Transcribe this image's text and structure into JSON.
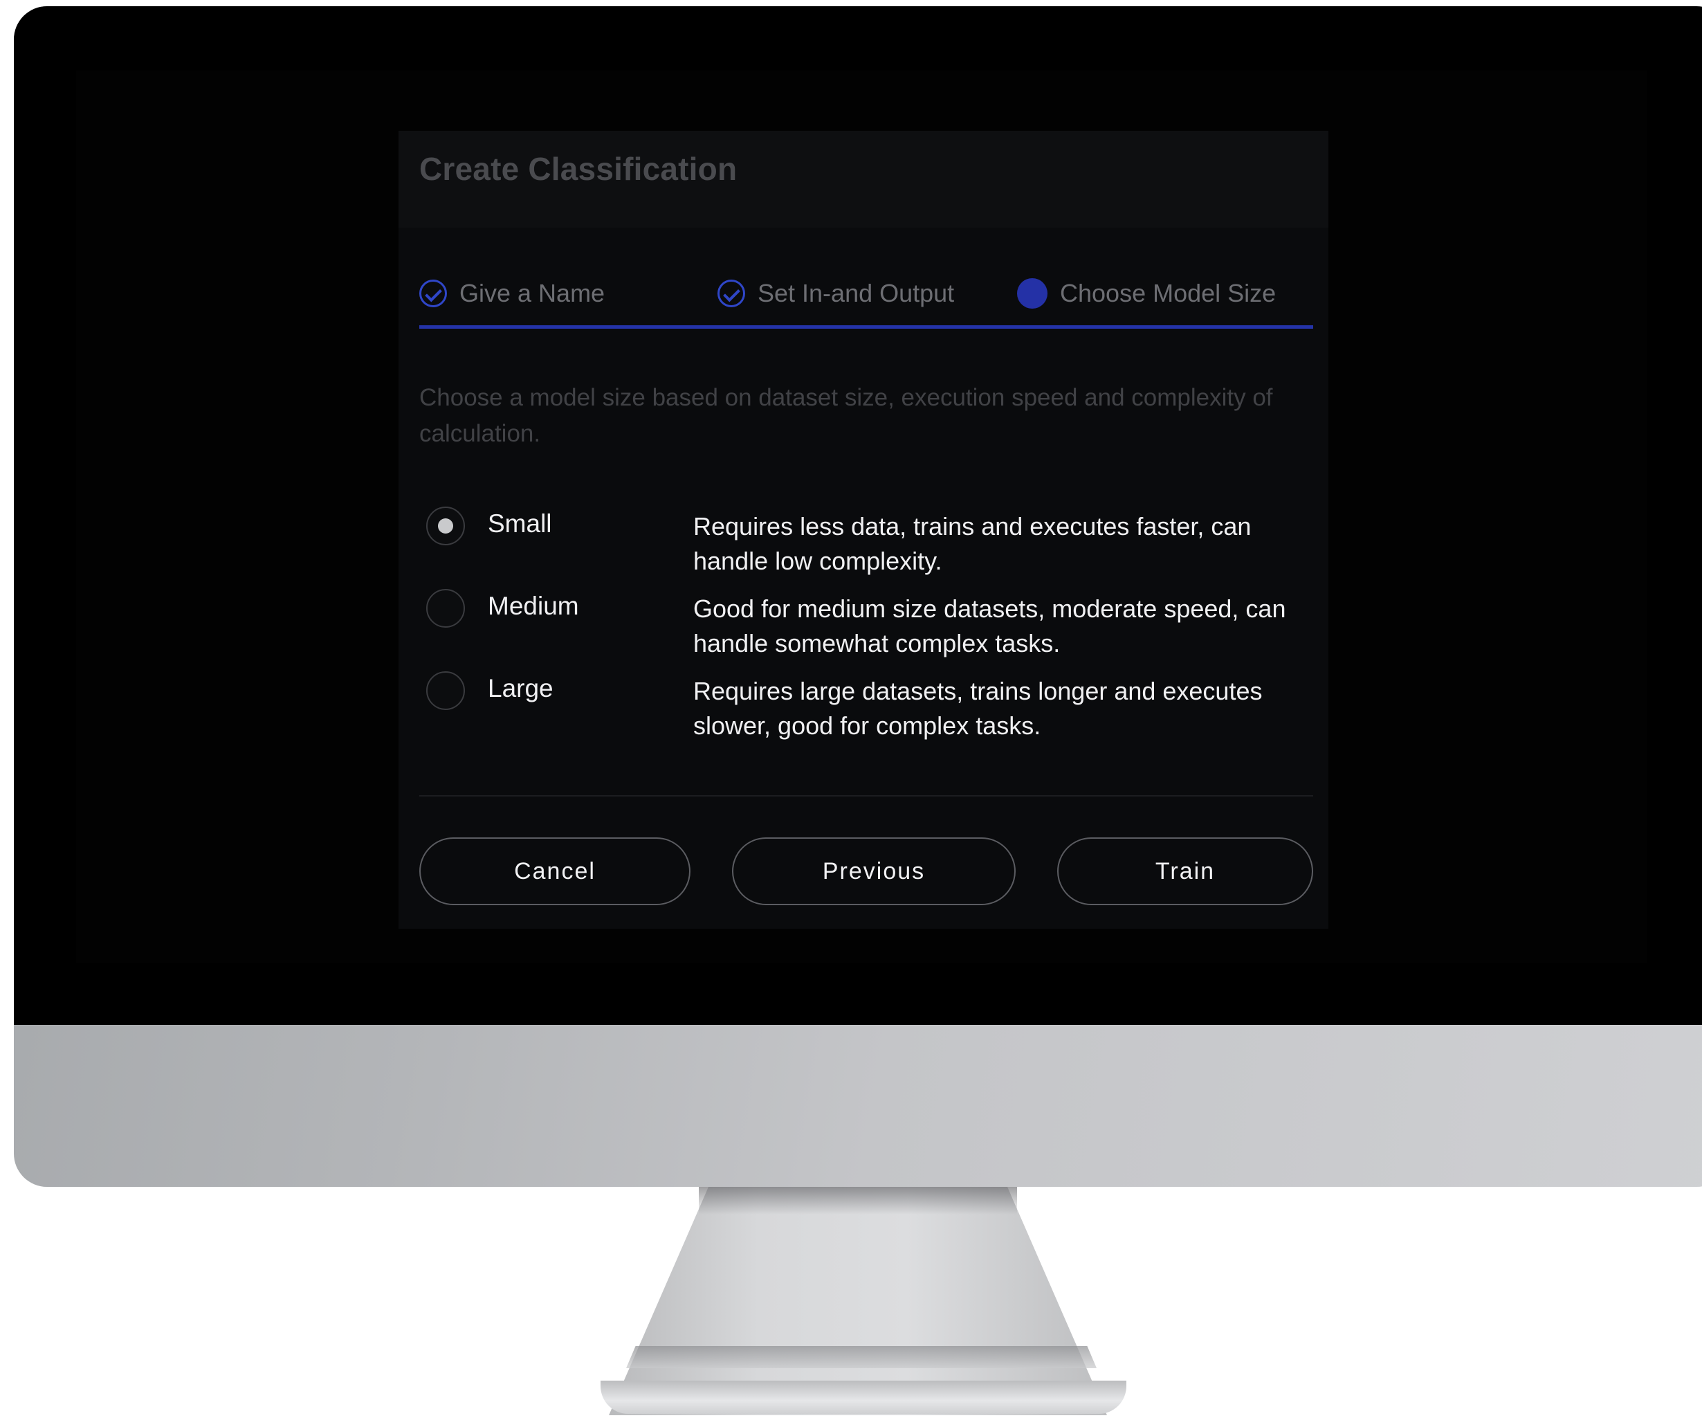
{
  "dialog": {
    "title": "Create Classification",
    "steps": [
      {
        "label": "Give a Name",
        "status": "done"
      },
      {
        "label": "Set In-and Output",
        "status": "done"
      },
      {
        "label": "Choose Model Size",
        "status": "current"
      }
    ],
    "intro": "Choose a model size based on dataset size, execution speed and complexity of calculation.",
    "options": [
      {
        "label": "Small",
        "description": "Requires less data, trains and executes faster, can handle low complexity.",
        "selected": true
      },
      {
        "label": "Medium",
        "description": "Good for medium size datasets, moderate speed, can handle somewhat complex tasks.",
        "selected": false
      },
      {
        "label": "Large",
        "description": "Requires large datasets, trains longer and executes slower, good for complex tasks.",
        "selected": false
      }
    ],
    "buttons": {
      "cancel": "Cancel",
      "previous": "Previous",
      "train": "Train"
    }
  },
  "colors": {
    "accent": "#2433a8",
    "dialog_bg": "#0a0b0d"
  }
}
